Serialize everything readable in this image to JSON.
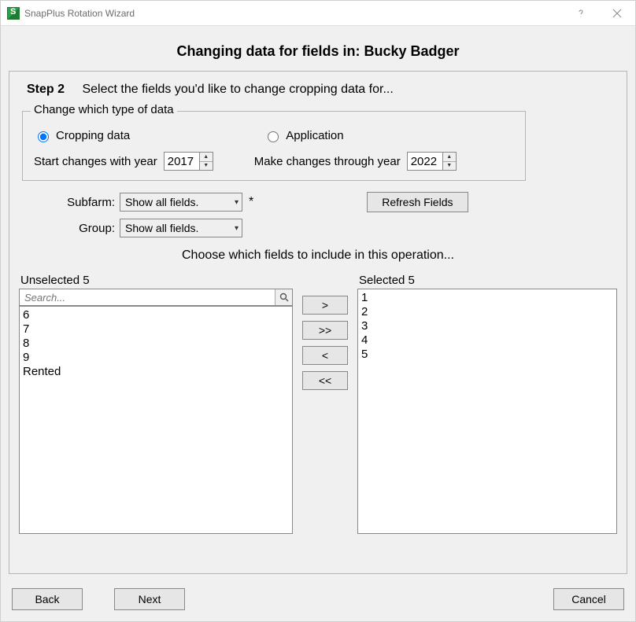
{
  "window": {
    "title": "SnapPlus Rotation Wizard"
  },
  "heading": "Changing data for fields in: Bucky Badger",
  "step": {
    "label": "Step 2",
    "text": "Select the fields you'd like to change cropping data for..."
  },
  "group": {
    "legend": "Change which type of data",
    "radio_cropping": "Cropping data",
    "radio_application": "Application",
    "radio_selected": "cropping",
    "start_label": "Start changes with year",
    "start_year": "2017",
    "through_label": "Make changes through year",
    "through_year": "2022"
  },
  "subfarm": {
    "label": "Subfarm:",
    "value": "Show all fields.",
    "asterisk": "*"
  },
  "group_filter": {
    "label": "Group:",
    "value": "Show all fields."
  },
  "refresh_label": "Refresh Fields",
  "choose_text": "Choose which fields to include in this operation...",
  "unselected": {
    "title": "Unselected 5",
    "search_placeholder": "Search...",
    "items": [
      "6",
      "7",
      "8",
      "9",
      "Rented"
    ]
  },
  "selected": {
    "title": "Selected 5",
    "items": [
      "1",
      "2",
      "3",
      "4",
      "5"
    ]
  },
  "mover": {
    "add": ">",
    "add_all": ">>",
    "remove": "<",
    "remove_all": "<<"
  },
  "footer": {
    "back": "Back",
    "next": "Next",
    "cancel": "Cancel"
  }
}
